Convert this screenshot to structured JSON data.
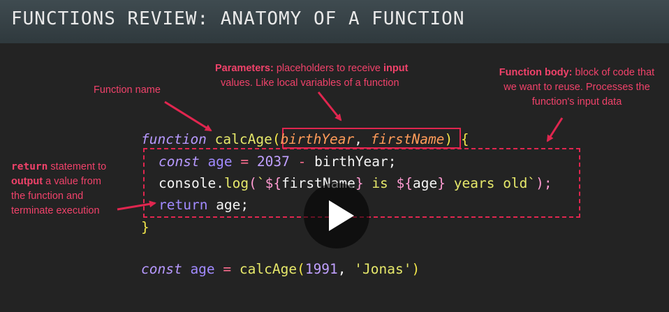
{
  "header": {
    "title": "FUNCTIONS REVIEW: ANATOMY OF A FUNCTION"
  },
  "annotations": {
    "function_name": "Function name",
    "parameters_bold": "Parameters:",
    "parameters_text_1": " placeholders to receive ",
    "parameters_input_bold": "input",
    "parameters_text_2": "values. Like local variables of a function",
    "body_bold": "Function body:",
    "body_text_1": " block of code that",
    "body_text_2": "we want to reuse. Processes the",
    "body_text_3": "function's input data",
    "return_keyword": "return",
    "return_text_1": " statement to",
    "return_output_bold": "output",
    "return_text_2": " a value from",
    "return_text_3": "the function and",
    "return_text_4": "terminate execution"
  },
  "code": {
    "l1_kw": "function",
    "l1_name": "calcAge",
    "l1_open": "(",
    "l1_p1": "birthYear",
    "l1_comma": ", ",
    "l1_p2": "firstName",
    "l1_close": ")",
    "l1_brace": " {",
    "l2_kw": "const",
    "l2_var": " age ",
    "l2_eq": "=",
    "l2_num": " 2037",
    "l2_minus": " -",
    "l2_rest": " birthYear;",
    "l3_console": "console",
    "l3_dot": ".",
    "l3_log": "log",
    "l3_open": "(",
    "l3_tick": "`",
    "l3_t1open": "${",
    "l3_t1var": "firstName",
    "l3_t1close": "}",
    "l3_is": " is ",
    "l3_t2open": "${",
    "l3_t2var": "age",
    "l3_t2close": "}",
    "l3_rest": " years old",
    "l3_tick2": "`",
    "l3_close": ");",
    "l4_kw": "return",
    "l4_rest": " age;",
    "l5_brace": "}",
    "l6_kw": "const",
    "l6_var": " age ",
    "l6_eq": "=",
    "l6_fn": " calcAge",
    "l6_open": "(",
    "l6_num": "1991",
    "l6_comma": ", ",
    "l6_str": "'Jonas'",
    "l6_close": ")"
  },
  "colors": {
    "accent": "#e0264f",
    "background": "#232323",
    "header": "#3a4549"
  },
  "icons": {
    "play": "play-icon"
  }
}
